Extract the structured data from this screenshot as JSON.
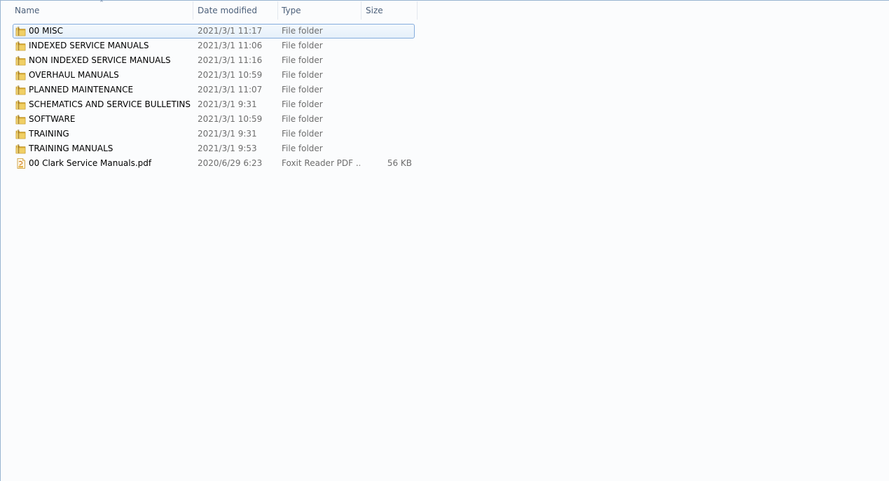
{
  "columns": {
    "name": "Name",
    "date": "Date modified",
    "type": "Type",
    "size": "Size"
  },
  "sort": {
    "column": "name",
    "direction": "ascending"
  },
  "rows": [
    {
      "name": "00 MISC",
      "date": "2021/3/1 11:17",
      "type": "File folder",
      "size": "",
      "icon": "folder-icon",
      "selected": true
    },
    {
      "name": "INDEXED SERVICE MANUALS",
      "date": "2021/3/1 11:06",
      "type": "File folder",
      "size": "",
      "icon": "folder-icon"
    },
    {
      "name": "NON INDEXED SERVICE MANUALS",
      "date": "2021/3/1 11:16",
      "type": "File folder",
      "size": "",
      "icon": "folder-icon"
    },
    {
      "name": "OVERHAUL MANUALS",
      "date": "2021/3/1 10:59",
      "type": "File folder",
      "size": "",
      "icon": "folder-icon"
    },
    {
      "name": "PLANNED MAINTENANCE",
      "date": "2021/3/1 11:07",
      "type": "File folder",
      "size": "",
      "icon": "folder-icon"
    },
    {
      "name": "SCHEMATICS AND SERVICE BULLETINS",
      "date": "2021/3/1 9:31",
      "type": "File folder",
      "size": "",
      "icon": "folder-icon"
    },
    {
      "name": "SOFTWARE",
      "date": "2021/3/1 10:59",
      "type": "File folder",
      "size": "",
      "icon": "folder-icon"
    },
    {
      "name": "TRAINING",
      "date": "2021/3/1 9:31",
      "type": "File folder",
      "size": "",
      "icon": "folder-icon"
    },
    {
      "name": "TRAINING MANUALS",
      "date": "2021/3/1 9:53",
      "type": "File folder",
      "size": "",
      "icon": "folder-icon"
    },
    {
      "name": "00 Clark Service Manuals.pdf",
      "date": "2020/6/29 6:23",
      "type": "Foxit Reader PDF ...",
      "size": "56 KB",
      "icon": "pdf-file-icon"
    }
  ],
  "colors": {
    "selection_border": "#84acdd",
    "header_text": "#4c607a",
    "folder_yellow": "#e8c04a",
    "background": "#fbfcfd"
  }
}
